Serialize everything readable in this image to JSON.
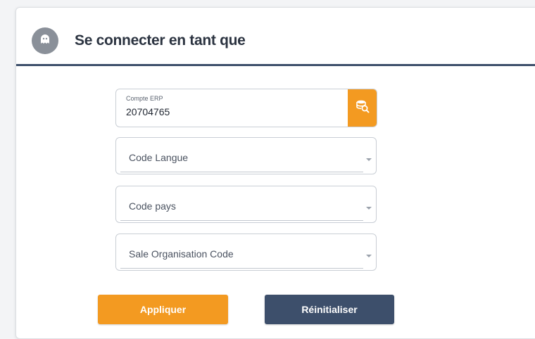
{
  "dialog": {
    "title": "Se connecter en tant que",
    "avatar_icon": "ghost-icon"
  },
  "form": {
    "erp_account": {
      "label": "Compte ERP",
      "value": "20704765",
      "search_icon": "database-search-icon"
    },
    "language_code": {
      "placeholder": "Code Langue"
    },
    "country_code": {
      "placeholder": "Code pays"
    },
    "sale_org_code": {
      "placeholder": "Sale Organisation Code"
    }
  },
  "actions": {
    "apply_label": "Appliquer",
    "reset_label": "Réinitialiser"
  },
  "colors": {
    "accent_orange": "#f39a21",
    "navy": "#3d4f6b",
    "avatar_gray": "#8a9099"
  }
}
